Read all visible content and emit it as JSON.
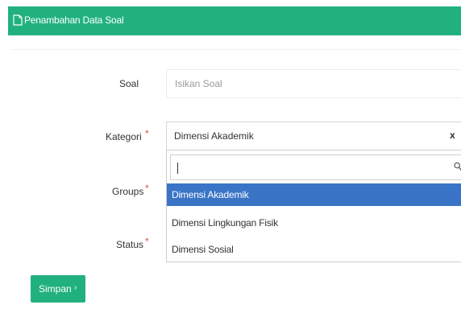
{
  "header": {
    "title": "Penambahan Data Soal",
    "icon": "document-icon"
  },
  "form": {
    "soal": {
      "label": "Soal",
      "placeholder": "Isikan Soal"
    },
    "kategori": {
      "label": "Kategori",
      "required_mark": "*",
      "selected_value": "Dimensi Akademik",
      "clear_symbol": "x"
    },
    "groups": {
      "label": "Groups",
      "required_mark": "*"
    },
    "status": {
      "label": "Status",
      "required_mark": "*"
    }
  },
  "dropdown": {
    "search_value": "",
    "options": [
      {
        "label": "Dimensi Akademik",
        "selected": true
      },
      {
        "label": "Dimensi Lingkungan Fisik",
        "selected": false
      },
      {
        "label": "Dimensi Sosial",
        "selected": false
      }
    ]
  },
  "actions": {
    "save_label": "Simpan",
    "save_arrow": "›"
  },
  "colors": {
    "header_bg": "#21b17f",
    "button_bg": "#21b17f",
    "selected_option_bg": "#3a74c6",
    "required_mark": "#d9534f"
  }
}
